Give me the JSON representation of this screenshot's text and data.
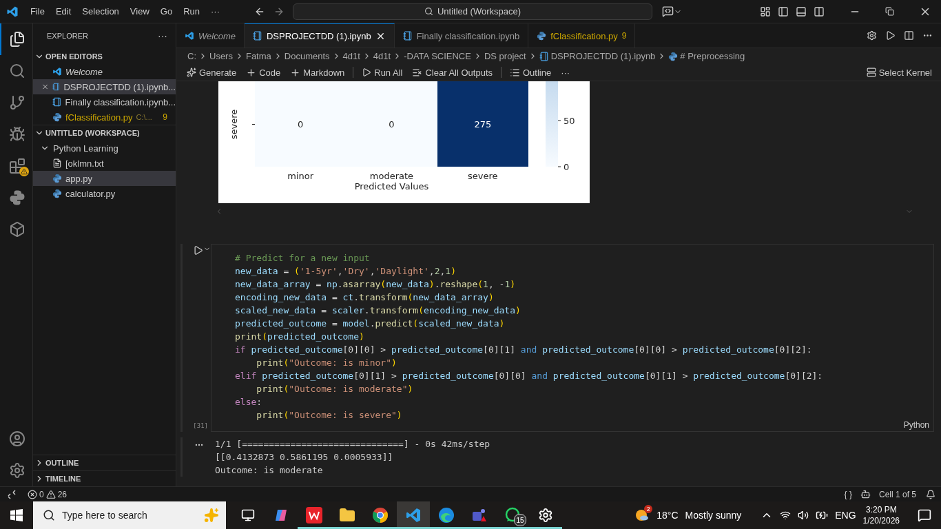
{
  "title_bar": {
    "menu": [
      "File",
      "Edit",
      "Selection",
      "View",
      "Go",
      "Run",
      "···"
    ],
    "search": "Untitled (Workspace)"
  },
  "activity_bar": [
    {
      "kind": "explorer",
      "selected": true,
      "warning": false
    },
    {
      "kind": "search",
      "selected": false,
      "warning": false
    },
    {
      "kind": "git",
      "selected": false,
      "warning": false
    },
    {
      "kind": "debug",
      "selected": false,
      "warning": false
    },
    {
      "kind": "extensions",
      "selected": false,
      "warning": true
    },
    {
      "kind": "python",
      "selected": false,
      "warning": false
    },
    {
      "kind": "containers",
      "selected": false,
      "warning": false
    }
  ],
  "sidebar": {
    "title": "EXPLORER",
    "more": "···",
    "open_editors": {
      "title": "OPEN EDITORS",
      "expanded": true,
      "items": [
        {
          "label": "Welcome",
          "kind": "vscode",
          "preview": true,
          "selected": false,
          "warning": false
        },
        {
          "label": "DSPROJECTDD (1).ipynb...",
          "kind": "notebook",
          "preview": false,
          "selected": true,
          "warning": false
        },
        {
          "label": "Finally classification.ipynb...",
          "kind": "notebook",
          "preview": false,
          "selected": false,
          "warning": false
        },
        {
          "label": "fClassification.py",
          "detail": "C:\\...",
          "problems": "9",
          "kind": "python",
          "preview": false,
          "selected": false,
          "warning": true
        }
      ]
    },
    "workspace": {
      "title": "UNTITLED (WORKSPACE)",
      "expanded": true,
      "tree": [
        {
          "label": "Python Learning",
          "expanded": true,
          "children": [
            {
              "label": "[oklmn.txt",
              "kind": "text",
              "selected": false
            },
            {
              "label": "app.py",
              "kind": "python",
              "selected": true
            },
            {
              "label": "calculator.py",
              "kind": "python",
              "selected": false
            }
          ]
        }
      ]
    },
    "bottom": [
      {
        "title": "OUTLINE",
        "expanded": false
      },
      {
        "title": "TIMELINE",
        "expanded": false
      }
    ]
  },
  "tabs": [
    {
      "label": "Welcome",
      "kind": "vscode",
      "preview": true,
      "selected": false,
      "warning": false
    },
    {
      "label": "DSPROJECTDD (1).ipynb",
      "kind": "notebook",
      "preview": false,
      "selected": true,
      "warning": false
    },
    {
      "label": "Finally classification.ipynb",
      "kind": "notebook",
      "preview": false,
      "selected": false,
      "warning": false
    },
    {
      "label": "fClassification.py",
      "kind": "python",
      "problems": "9",
      "preview": false,
      "selected": false,
      "warning": true
    }
  ],
  "breadcrumbs": [
    {
      "label": "C:"
    },
    {
      "label": "Users"
    },
    {
      "label": "Fatma"
    },
    {
      "label": "Documents"
    },
    {
      "label": "4d1t"
    },
    {
      "label": "4d1t"
    },
    {
      "label": "-DATA SCIENCE"
    },
    {
      "label": "DS project"
    },
    {
      "label": "DSPROJECTDD (1).ipynb",
      "kind": "notebook"
    },
    {
      "label": "# Preprocessing",
      "kind": "python"
    }
  ],
  "toolbar": {
    "items": [
      {
        "kind": "generate",
        "label": "Generate"
      },
      {
        "kind": "add",
        "label": "Code"
      },
      {
        "kind": "add",
        "label": "Markdown"
      },
      {
        "kind": "separator"
      },
      {
        "kind": "run",
        "label": "Run All"
      },
      {
        "kind": "clear",
        "label": "Clear All Outputs"
      },
      {
        "kind": "separator"
      },
      {
        "kind": "outline",
        "label": "Outline"
      },
      {
        "kind": "more",
        "label": "···"
      }
    ],
    "kernel": "Select Kernel"
  },
  "heatmap": {
    "row_label": "severe",
    "cells": [
      {
        "value": "0",
        "color": "#f7fbff"
      },
      {
        "value": "0",
        "color": "#f7fbff"
      },
      {
        "value": "275",
        "color": "#08306b"
      }
    ],
    "x_labels": [
      "minor",
      "moderate",
      "severe"
    ],
    "xlabel": "Predicted Values",
    "colorbar_ticks": [
      "50",
      "0"
    ]
  },
  "cell": {
    "count": "[31]",
    "language": "Python",
    "lines": [
      [
        {
          "kind": "comment",
          "text": "# Predict for a new input"
        }
      ],
      [
        {
          "kind": "name",
          "text": "new_data"
        },
        {
          "kind": "op",
          "text": " = "
        },
        {
          "kind": "paren",
          "text": "("
        },
        {
          "kind": "string",
          "text": "'1-5yr'"
        },
        {
          "kind": "op",
          "text": ","
        },
        {
          "kind": "string",
          "text": "'Dry'"
        },
        {
          "kind": "op",
          "text": ","
        },
        {
          "kind": "string",
          "text": "'Daylight'"
        },
        {
          "kind": "op",
          "text": ","
        },
        {
          "kind": "number",
          "text": "2"
        },
        {
          "kind": "op",
          "text": ","
        },
        {
          "kind": "number",
          "text": "1"
        },
        {
          "kind": "paren",
          "text": ")"
        }
      ],
      [
        {
          "kind": "name",
          "text": "new_data_array"
        },
        {
          "kind": "op",
          "text": " = "
        },
        {
          "kind": "name",
          "text": "np"
        },
        {
          "kind": "op",
          "text": "."
        },
        {
          "kind": "func",
          "text": "asarray"
        },
        {
          "kind": "paren",
          "text": "("
        },
        {
          "kind": "name",
          "text": "new_data"
        },
        {
          "kind": "paren",
          "text": ")"
        },
        {
          "kind": "op",
          "text": "."
        },
        {
          "kind": "func",
          "text": "reshape"
        },
        {
          "kind": "paren",
          "text": "("
        },
        {
          "kind": "number",
          "text": "1"
        },
        {
          "kind": "op",
          "text": ", -"
        },
        {
          "kind": "number",
          "text": "1"
        },
        {
          "kind": "paren",
          "text": ")"
        }
      ],
      [
        {
          "kind": "name",
          "text": "encoding_new_data"
        },
        {
          "kind": "op",
          "text": " = "
        },
        {
          "kind": "name",
          "text": "ct"
        },
        {
          "kind": "op",
          "text": "."
        },
        {
          "kind": "func",
          "text": "transform"
        },
        {
          "kind": "paren",
          "text": "("
        },
        {
          "kind": "name",
          "text": "new_data_array"
        },
        {
          "kind": "paren",
          "text": ")"
        }
      ],
      [
        {
          "kind": "name",
          "text": "scaled_new_data"
        },
        {
          "kind": "op",
          "text": " = "
        },
        {
          "kind": "name",
          "text": "scaler"
        },
        {
          "kind": "op",
          "text": "."
        },
        {
          "kind": "func",
          "text": "transform"
        },
        {
          "kind": "paren",
          "text": "("
        },
        {
          "kind": "name",
          "text": "encoding_new_data"
        },
        {
          "kind": "paren",
          "text": ")"
        }
      ],
      [
        {
          "kind": "name",
          "text": "predicted_outcome"
        },
        {
          "kind": "op",
          "text": " = "
        },
        {
          "kind": "name",
          "text": "model"
        },
        {
          "kind": "op",
          "text": "."
        },
        {
          "kind": "func",
          "text": "predict"
        },
        {
          "kind": "paren",
          "text": "("
        },
        {
          "kind": "name",
          "text": "scaled_new_data"
        },
        {
          "kind": "paren",
          "text": ")"
        }
      ],
      [
        {
          "kind": "func",
          "text": "print"
        },
        {
          "kind": "paren",
          "text": "("
        },
        {
          "kind": "name",
          "text": "predicted_outcome"
        },
        {
          "kind": "paren",
          "text": ")"
        }
      ],
      [
        {
          "kind": "keyword",
          "text": "if "
        },
        {
          "kind": "name",
          "text": "predicted_outcome"
        },
        {
          "kind": "op",
          "text": "[0][0] > "
        },
        {
          "kind": "name",
          "text": "predicted_outcome"
        },
        {
          "kind": "op",
          "text": "[0][1] "
        },
        {
          "kind": "logic",
          "text": "and "
        },
        {
          "kind": "name",
          "text": "predicted_outcome"
        },
        {
          "kind": "op",
          "text": "[0][0] > "
        },
        {
          "kind": "name",
          "text": "predicted_outcome"
        },
        {
          "kind": "op",
          "text": "[0][2]:"
        }
      ],
      [
        {
          "kind": "func",
          "text": "    print"
        },
        {
          "kind": "paren",
          "text": "("
        },
        {
          "kind": "string",
          "text": "\"Outcome: is minor\""
        },
        {
          "kind": "paren",
          "text": ")"
        }
      ],
      [
        {
          "kind": "keyword",
          "text": "elif "
        },
        {
          "kind": "name",
          "text": "predicted_outcome"
        },
        {
          "kind": "op",
          "text": "[0][1] > "
        },
        {
          "kind": "name",
          "text": "predicted_outcome"
        },
        {
          "kind": "op",
          "text": "[0][0] "
        },
        {
          "kind": "logic",
          "text": "and "
        },
        {
          "kind": "name",
          "text": "predicted_outcome"
        },
        {
          "kind": "op",
          "text": "[0][1] > "
        },
        {
          "kind": "name",
          "text": "predicted_outcome"
        },
        {
          "kind": "op",
          "text": "[0][2]:"
        }
      ],
      [
        {
          "kind": "func",
          "text": "    print"
        },
        {
          "kind": "paren",
          "text": "("
        },
        {
          "kind": "string",
          "text": "\"Outcome: is moderate\""
        },
        {
          "kind": "paren",
          "text": ")"
        }
      ],
      [
        {
          "kind": "keyword",
          "text": "else"
        },
        {
          "kind": "op",
          "text": ":"
        }
      ],
      [
        {
          "kind": "func",
          "text": "    print"
        },
        {
          "kind": "paren",
          "text": "("
        },
        {
          "kind": "string",
          "text": "\"Outcome: is severe\""
        },
        {
          "kind": "paren",
          "text": ")"
        }
      ]
    ],
    "output": [
      "1/1 [==============================] - 0s 42ms/step",
      "[[0.4132873 0.5861195 0.0005933]]",
      "Outcome: is moderate"
    ]
  },
  "status_bar": {
    "errors": "0",
    "warnings": "26",
    "brackets": "{ }",
    "cell_position": "Cell 1 of 5"
  },
  "taskbar": {
    "search_placeholder": "Type here to search",
    "apps": [
      {
        "kind": "taskview",
        "running": false,
        "active": false
      },
      {
        "kind": "copilot",
        "running": false,
        "active": false
      },
      {
        "kind": "wps",
        "running": true,
        "active": false
      },
      {
        "kind": "folder",
        "running": true,
        "active": false
      },
      {
        "kind": "chrome",
        "running": true,
        "active": false
      },
      {
        "kind": "vscode",
        "running": true,
        "active": true
      },
      {
        "kind": "edge",
        "running": true,
        "active": false
      },
      {
        "kind": "teams",
        "running": true,
        "active": false
      },
      {
        "kind": "whatsapp",
        "running": true,
        "active": false,
        "badge": "15"
      },
      {
        "kind": "settings",
        "running": true,
        "active": false
      }
    ],
    "weather": {
      "badge": "2",
      "temp": "18°C",
      "text": "Mostly sunny"
    },
    "language": "ENG",
    "time": "3:20 PM",
    "date": "1/20/2026"
  }
}
